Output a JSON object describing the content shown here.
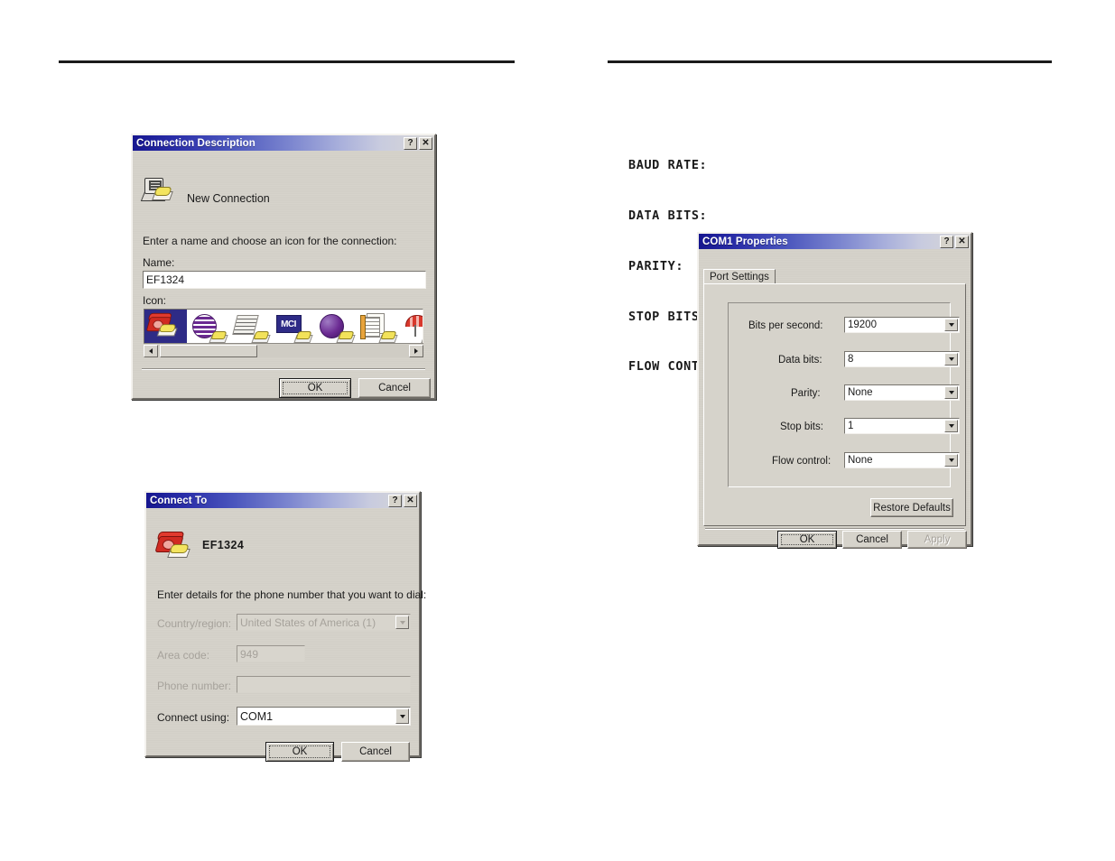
{
  "page": {
    "rules": [
      "top-rule-left-column",
      "top-rule-right-column"
    ]
  },
  "spec_list": {
    "lines": [
      "BAUD RATE:",
      "DATA BITS:",
      "PARITY:",
      "STOP BITS:",
      "FLOW CONTROL:"
    ]
  },
  "connection_description": {
    "title": "Connection Description",
    "help_button": "?",
    "close_button": "✕",
    "connection_icon_label": "New Connection",
    "instruction": "Enter a name and choose an icon for the connection:",
    "name_label": "Name:",
    "name_value": "EF1324",
    "icon_label": "Icon:",
    "icons": [
      {
        "name": "red-telephone-icon",
        "selected": true
      },
      {
        "name": "purple-striped-globe-icon",
        "selected": false
      },
      {
        "name": "fax-document-icon",
        "selected": false
      },
      {
        "name": "mci-logo-icon",
        "selected": false,
        "text": "MCI"
      },
      {
        "name": "purple-sphere-icon",
        "selected": false
      },
      {
        "name": "notepad-documents-icon",
        "selected": false
      },
      {
        "name": "red-umbrella-icon",
        "selected": false
      }
    ],
    "scroll_left": "◀",
    "scroll_right": "▶",
    "ok_label": "OK",
    "cancel_label": "Cancel"
  },
  "connect_to": {
    "title": "Connect To",
    "help_button": "?",
    "close_button": "✕",
    "connection_name": "EF1324",
    "instruction": "Enter details for the phone number that you want to dial:",
    "fields": [
      {
        "label": "Country/region:",
        "value": "United States of America (1)",
        "disabled": true,
        "combo": true
      },
      {
        "label": "Area code:",
        "value": "949",
        "disabled": true,
        "combo": false
      },
      {
        "label": "Phone number:",
        "value": "",
        "disabled": true,
        "combo": false
      },
      {
        "label": "Connect using:",
        "value": "COM1",
        "disabled": false,
        "combo": true
      }
    ],
    "ok_label": "OK",
    "cancel_label": "Cancel"
  },
  "com1_properties": {
    "title": "COM1 Properties",
    "help_button": "?",
    "close_button": "✕",
    "tab_label": "Port Settings",
    "settings": [
      {
        "label": "Bits per second:",
        "value": "19200"
      },
      {
        "label": "Data bits:",
        "value": "8"
      },
      {
        "label": "Parity:",
        "value": "None"
      },
      {
        "label": "Stop bits:",
        "value": "1"
      },
      {
        "label": "Flow control:",
        "value": "None"
      }
    ],
    "restore_defaults_label": "Restore Defaults",
    "ok_label": "OK",
    "cancel_label": "Cancel",
    "apply_label": "Apply",
    "apply_disabled": true
  },
  "colors": {
    "title_gradient_start": "#16168f",
    "title_gradient_end": "#d9d8d6",
    "dialog_face": "#d6d3cb",
    "selection_blue": "#2e2b86",
    "text": "#1a1a1a",
    "disabled_text": "#a6a29b",
    "rule": "#1b1b1b"
  }
}
